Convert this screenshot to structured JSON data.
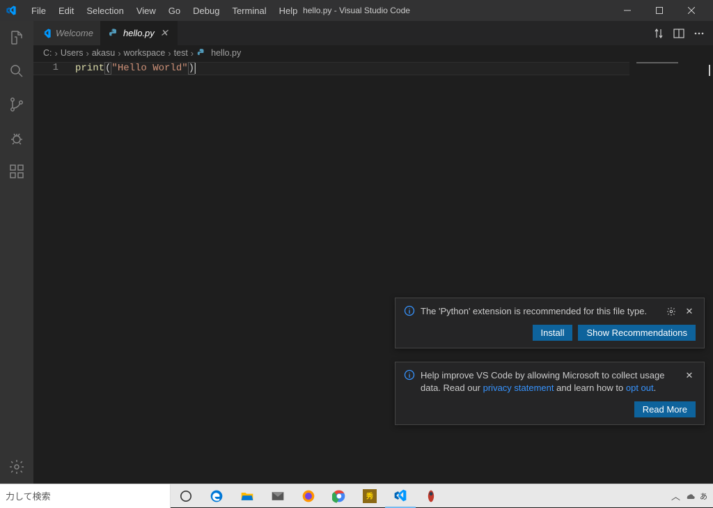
{
  "window": {
    "title": "hello.py - Visual Studio Code"
  },
  "menubar": [
    "File",
    "Edit",
    "Selection",
    "View",
    "Go",
    "Debug",
    "Terminal",
    "Help"
  ],
  "tabs": [
    {
      "label": "Welcome",
      "icon": "vscode"
    },
    {
      "label": "hello.py",
      "icon": "python",
      "active": true
    }
  ],
  "breadcrumb": [
    "C:",
    "Users",
    "akasu",
    "workspace",
    "test",
    "hello.py"
  ],
  "code": {
    "line_number": "1",
    "fn": "print",
    "string": "\"Hello World\""
  },
  "notifications": {
    "python_rec": {
      "message": "The 'Python' extension is recommended for this file type.",
      "install": "Install",
      "show": "Show Recommendations"
    },
    "telemetry": {
      "prefix": "Help improve VS Code by allowing Microsoft to collect usage data. Read our ",
      "privacy_link": "privacy statement",
      "mid": " and learn how to ",
      "opt_out_link": "opt out",
      "suffix": ".",
      "read_more": "Read More"
    }
  },
  "taskbar": {
    "search_placeholder": "力して検索"
  }
}
